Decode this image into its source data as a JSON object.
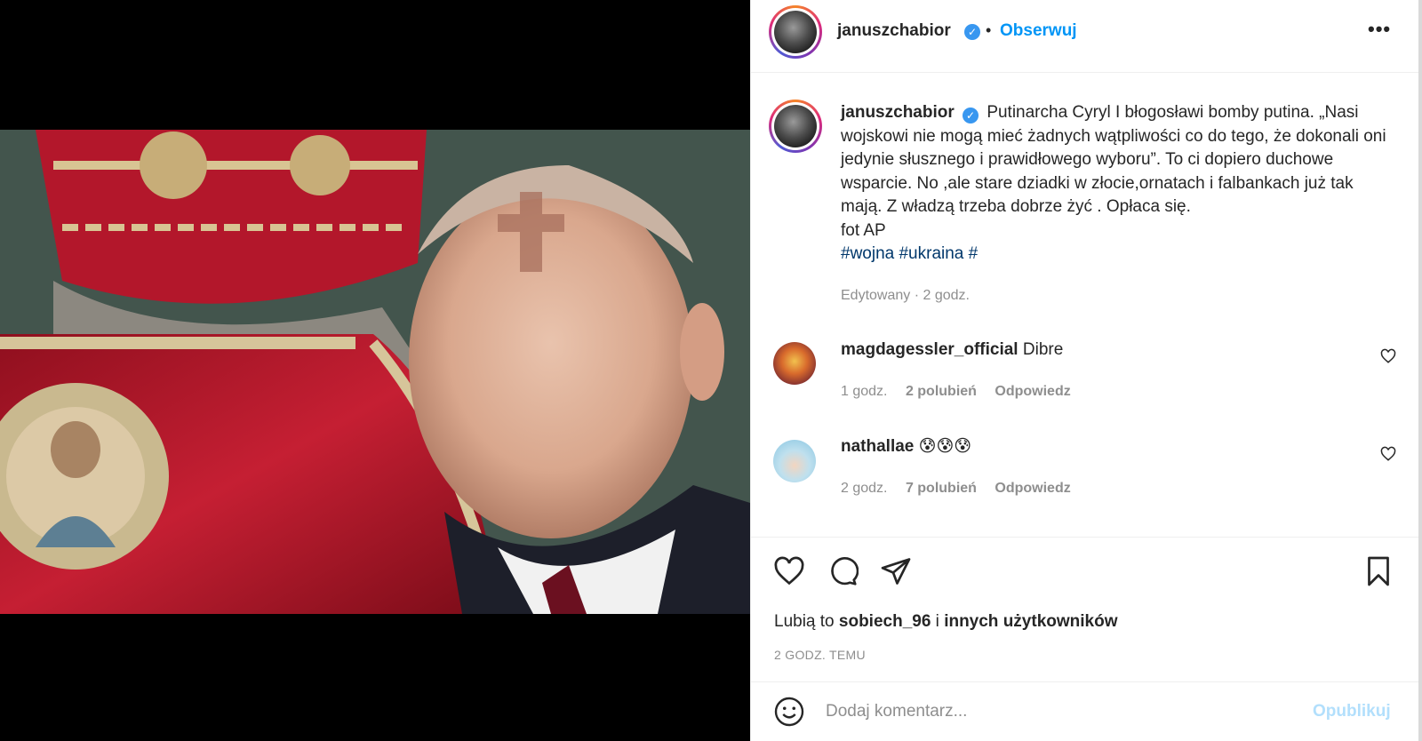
{
  "header": {
    "username": "januszchabior",
    "verified_icon": "verified-badge-icon",
    "separator": "•",
    "follow_label": "Obserwuj",
    "more_label": "•••"
  },
  "caption": {
    "username": "januszchabior",
    "text": "Putinarcha Cyryl I błogosławi bomby putina. „Nasi wojskowi nie mogą mieć żadnych wątpliwości co do tego, że dokonali oni jedynie słusznego i prawidłowego wyboru”. To ci dopiero duchowe wsparcie. No ,ale stare dziadki w złocie,ornatach i falbankach już tak mają. Z władzą trzeba dobrze żyć . Opłaca się.",
    "credit": "fot AP",
    "tags": "#wojna #ukraina #",
    "meta": "Edytowany · 2 godz."
  },
  "comments": [
    {
      "username": "magdagessler_official",
      "text": "Dibre",
      "time": "1 godz.",
      "likes": "2 polubień",
      "reply": "Odpowiedz"
    },
    {
      "username": "nathallae",
      "text": "😰😰😰",
      "time": "2 godz.",
      "likes": "7 polubień",
      "reply": "Odpowiedz"
    }
  ],
  "actions": {
    "icons": [
      "heart-icon",
      "comment-icon",
      "share-icon",
      "bookmark-icon"
    ],
    "likes_prefix": "Lubią to ",
    "likes_user": "sobiech_96",
    "likes_mid": " i ",
    "likes_others": "innych użytkowników",
    "timeago": "2 GODZ. TEMU"
  },
  "comment_box": {
    "placeholder": "Dodaj komentarz...",
    "publish_label": "Opublikuj"
  },
  "colors": {
    "accent": "#0095f6",
    "verified": "#3897f0",
    "muted": "#8e8e8e",
    "hashtag": "#00376b",
    "publish_disabled": "#b2dffc"
  }
}
